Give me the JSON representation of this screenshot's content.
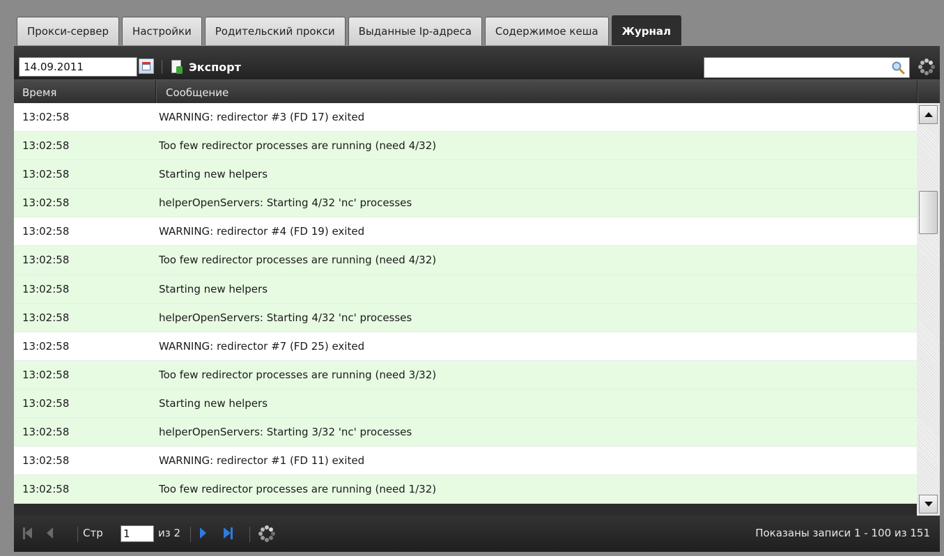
{
  "tabs": [
    {
      "label": "Прокси-сервер"
    },
    {
      "label": "Настройки"
    },
    {
      "label": "Родительский прокси"
    },
    {
      "label": "Выданные Ip-адреса"
    },
    {
      "label": "Содержимое кеша"
    },
    {
      "label": "Журнал"
    }
  ],
  "active_tab": "Журнал",
  "toolbar": {
    "date_value": "14.09.2011",
    "export_label": "Экспорт",
    "search_value": ""
  },
  "grid": {
    "columns": [
      "Время",
      "Сообщение"
    ],
    "rows": [
      {
        "time": "13:02:58",
        "message": "WARNING: redirector #3 (FD 17) exited"
      },
      {
        "time": "13:02:58",
        "message": "Too few redirector processes are running (need 4/32)"
      },
      {
        "time": "13:02:58",
        "message": "Starting new helpers"
      },
      {
        "time": "13:02:58",
        "message": "helperOpenServers: Starting 4/32 'nc' processes"
      },
      {
        "time": "13:02:58",
        "message": "WARNING: redirector #4 (FD 19) exited"
      },
      {
        "time": "13:02:58",
        "message": "Too few redirector processes are running (need 4/32)"
      },
      {
        "time": "13:02:58",
        "message": "Starting new helpers"
      },
      {
        "time": "13:02:58",
        "message": "helperOpenServers: Starting 4/32 'nc' processes"
      },
      {
        "time": "13:02:58",
        "message": "WARNING: redirector #7 (FD 25) exited"
      },
      {
        "time": "13:02:58",
        "message": "Too few redirector processes are running (need 3/32)"
      },
      {
        "time": "13:02:58",
        "message": "Starting new helpers"
      },
      {
        "time": "13:02:58",
        "message": "helperOpenServers: Starting 3/32 'nc' processes"
      },
      {
        "time": "13:02:58",
        "message": "WARNING: redirector #1 (FD 11) exited"
      },
      {
        "time": "13:02:58",
        "message": "Too few redirector processes are running (need 1/32)"
      }
    ]
  },
  "pager": {
    "page_label": "Стр",
    "page_value": "1",
    "of_label": "из 2",
    "status": "Показаны записи 1 - 100 из 151"
  },
  "icons": {
    "date": "calendar-icon",
    "export": "export-icon",
    "search": "search-icon",
    "refresh": "refresh-spinner-icon",
    "first": "first-page-icon",
    "prev": "prev-page-icon",
    "next": "next-page-icon",
    "last": "last-page-icon"
  },
  "colors": {
    "row_alt": "#e7fbe3",
    "panel": "#2c2c2c",
    "pager_active": "#2f7be0"
  }
}
